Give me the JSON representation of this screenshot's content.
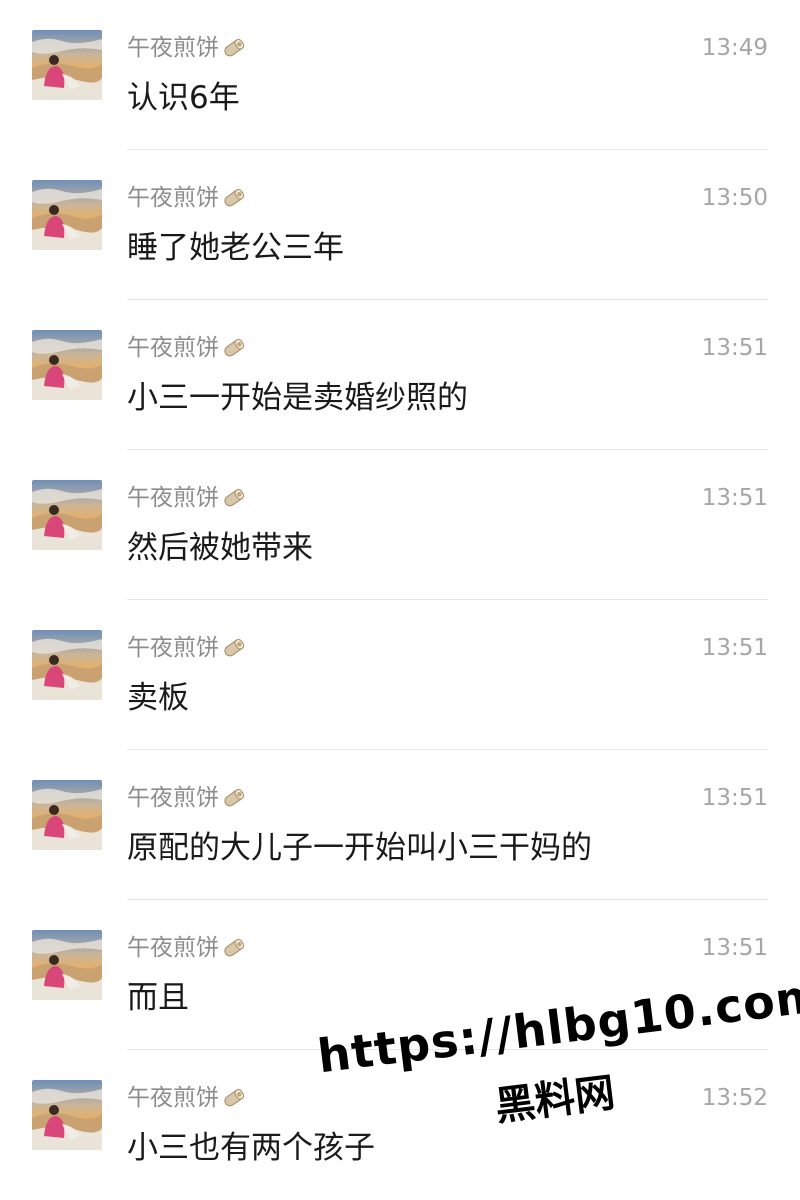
{
  "colors": {
    "sender": "#8c8c8c",
    "time": "#a6a6a6",
    "text": "#1a1a1a",
    "divider": "#e6e6e6",
    "watermark": "#000000"
  },
  "messages": [
    {
      "sender": "午夜煎饼",
      "sender_icon": "egg-roll-icon",
      "time": "13:49",
      "text": "认识6年"
    },
    {
      "sender": "午夜煎饼",
      "sender_icon": "egg-roll-icon",
      "time": "13:50",
      "text": "睡了她老公三年"
    },
    {
      "sender": "午夜煎饼",
      "sender_icon": "egg-roll-icon",
      "time": "13:51",
      "text": "小三一开始是卖婚纱照的"
    },
    {
      "sender": "午夜煎饼",
      "sender_icon": "egg-roll-icon",
      "time": "13:51",
      "text": "然后被她带来"
    },
    {
      "sender": "午夜煎饼",
      "sender_icon": "egg-roll-icon",
      "time": "13:51",
      "text": "卖板"
    },
    {
      "sender": "午夜煎饼",
      "sender_icon": "egg-roll-icon",
      "time": "13:51",
      "text": "原配的大儿子一开始叫小三干妈的"
    },
    {
      "sender": "午夜煎饼",
      "sender_icon": "egg-roll-icon",
      "time": "13:51",
      "text": "而且"
    },
    {
      "sender": "午夜煎饼",
      "sender_icon": "egg-roll-icon",
      "time": "13:52",
      "text": "小三也有两个孩子"
    }
  ],
  "watermark": {
    "url": "https://hlbg10.com",
    "name": "黑料网"
  }
}
